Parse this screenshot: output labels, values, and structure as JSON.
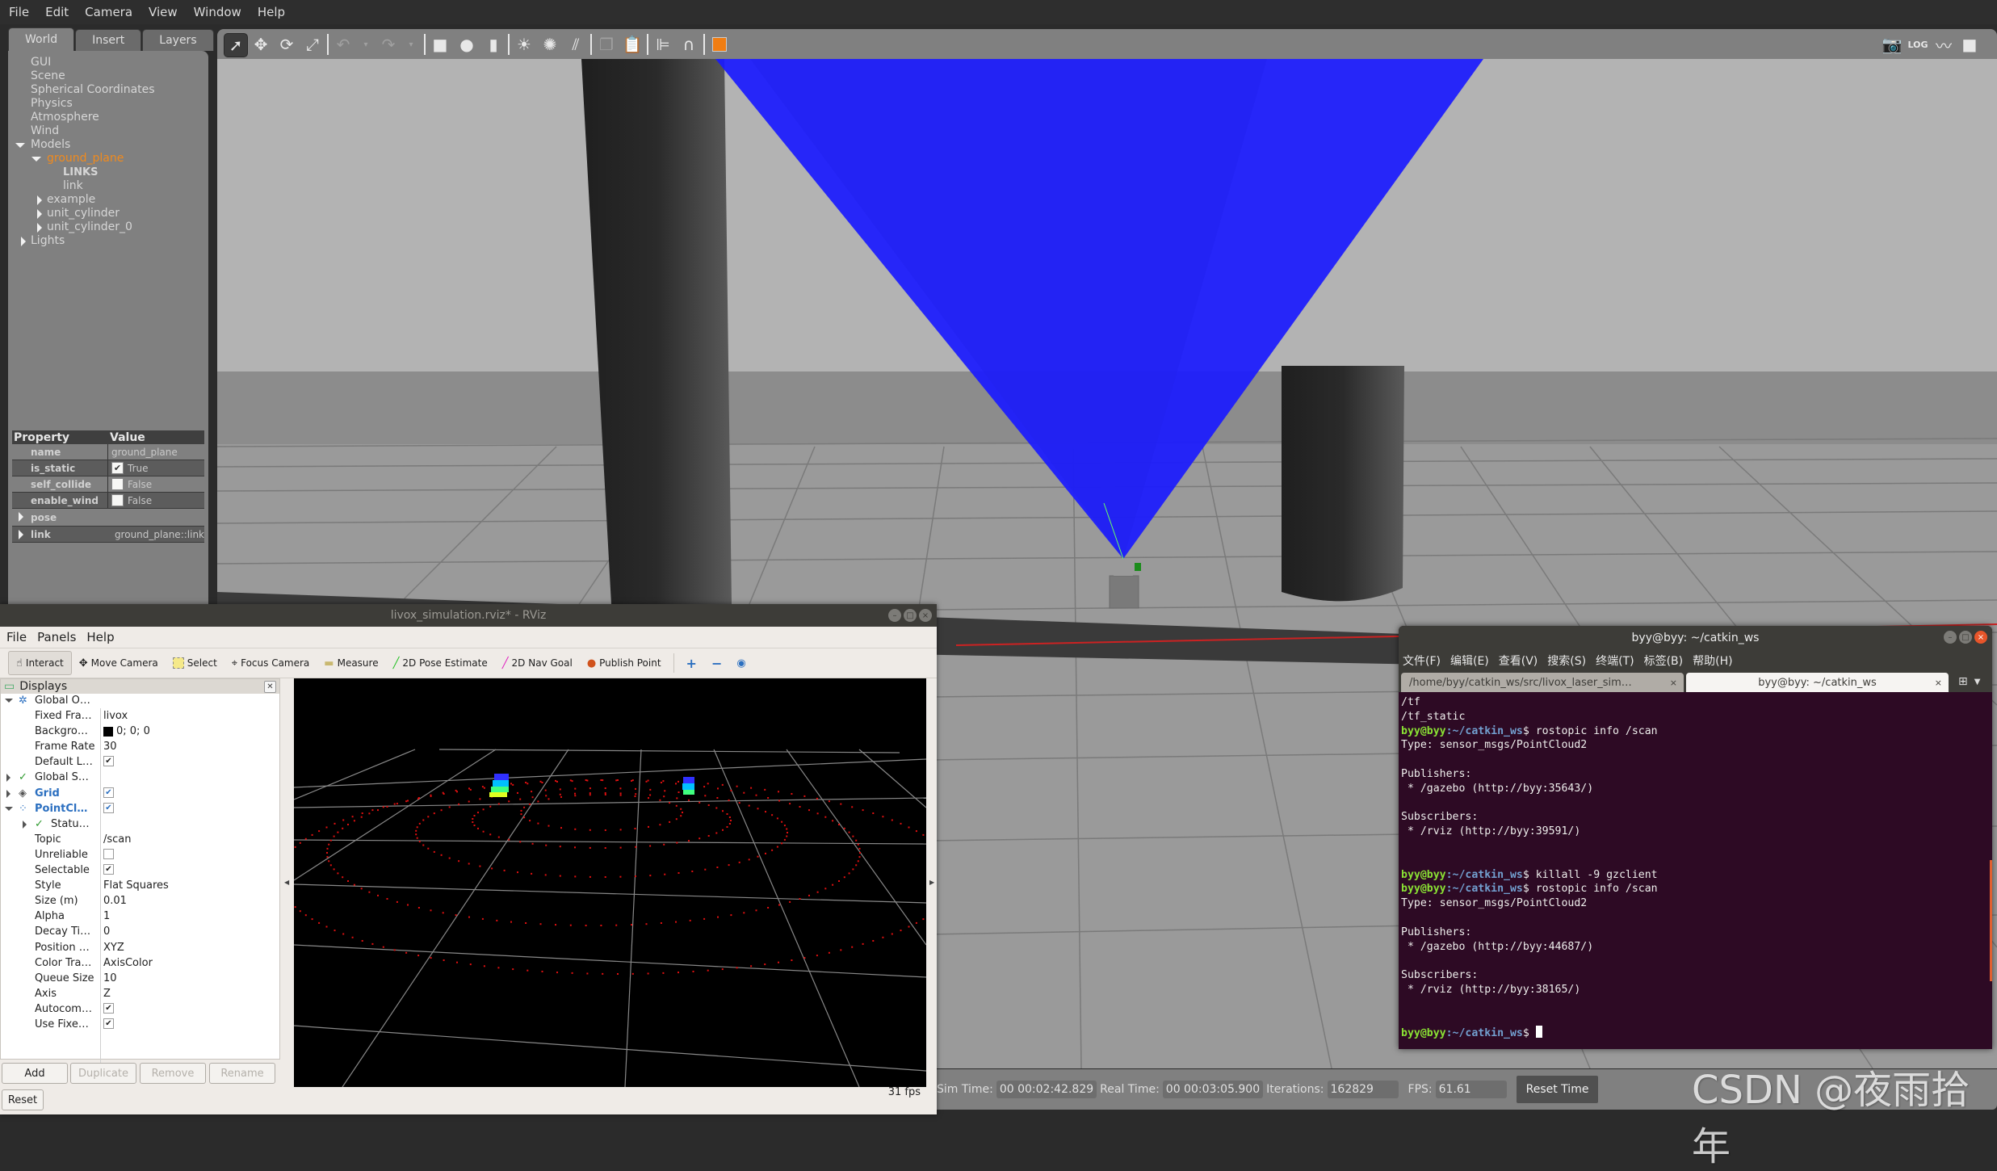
{
  "gazebo": {
    "menu": [
      "File",
      "Edit",
      "Camera",
      "View",
      "Window",
      "Help"
    ],
    "tabs": [
      "World",
      "Insert",
      "Layers"
    ],
    "world_tree": {
      "items": [
        "GUI",
        "Scene",
        "Spherical Coordinates",
        "Physics",
        "Atmosphere",
        "Wind"
      ],
      "models_label": "Models",
      "selected_model": "ground_plane",
      "links_header": "LINKS",
      "link": "link",
      "other_models": [
        "example",
        "unit_cylinder",
        "unit_cylinder_0"
      ],
      "lights_label": "Lights"
    },
    "properties": {
      "header_property": "Property",
      "header_value": "Value",
      "rows": [
        {
          "key": "name",
          "value": "ground_plane"
        },
        {
          "key": "is_static",
          "value": "True",
          "checked": true
        },
        {
          "key": "self_collide",
          "value": "False",
          "checked": false
        },
        {
          "key": "enable_wind",
          "value": "False",
          "checked": false
        }
      ],
      "groups": [
        {
          "key": "pose",
          "value": ""
        },
        {
          "key": "link",
          "value": "ground_plane::link"
        }
      ]
    },
    "toolbar_icons": [
      "select-mode",
      "translate-mode",
      "rotate-mode",
      "scale-mode",
      "undo",
      "redo",
      "box",
      "sphere",
      "cylinder",
      "point-light",
      "spot-light",
      "directional-light",
      "copy",
      "paste",
      "align",
      "snap",
      "view-angle"
    ],
    "toolbar_right_icons": [
      "screenshot",
      "log",
      "plot",
      "video-record"
    ],
    "status": {
      "sim_time_label": "Sim Time:",
      "sim_time": "00 00:02:42.829",
      "real_time_label": "Real Time:",
      "real_time": "00 00:03:05.900",
      "iterations_label": "Iterations:",
      "iterations": "162829",
      "fps_label": "FPS:",
      "fps": "61.61",
      "reset_time": "Reset Time"
    },
    "colors": {
      "laser_ray": "#1a1aff",
      "selected_model": "#f08a1d"
    }
  },
  "rviz": {
    "title": "livox_simulation.rviz* - RViz",
    "menu": [
      "File",
      "Panels",
      "Help"
    ],
    "tools": [
      {
        "label": "Interact",
        "icon": "☝"
      },
      {
        "label": "Move Camera",
        "icon": "✥"
      },
      {
        "label": "Select",
        "icon": "▭"
      },
      {
        "label": "Focus Camera",
        "icon": "⌖"
      },
      {
        "label": "Measure",
        "icon": "▬"
      },
      {
        "label": "2D Pose Estimate",
        "icon": "╱"
      },
      {
        "label": "2D Nav Goal",
        "icon": "╱"
      },
      {
        "label": "Publish Point",
        "icon": "●"
      }
    ],
    "displays_title": "Displays",
    "displays": {
      "global_options": "Global O…",
      "fixed_frame_k": "Fixed Fra…",
      "fixed_frame_v": "livox",
      "background_k": "Backgro…",
      "background_v": "0; 0; 0",
      "frame_rate_k": "Frame Rate",
      "frame_rate_v": "30",
      "default_light_k": "Default L…",
      "global_status": "Global S…",
      "grid": "Grid",
      "pointcloud": "PointCl…",
      "status": "Statu…",
      "topic_k": "Topic",
      "topic_v": "/scan",
      "unreliable_k": "Unreliable",
      "selectable_k": "Selectable",
      "style_k": "Style",
      "style_v": "Flat Squares",
      "size_k": "Size (m)",
      "size_v": "0.01",
      "alpha_k": "Alpha",
      "alpha_v": "1",
      "decay_k": "Decay Ti…",
      "decay_v": "0",
      "position_k": "Position …",
      "position_v": "XYZ",
      "color_k": "Color Tra…",
      "color_v": "AxisColor",
      "queue_k": "Queue Size",
      "queue_v": "10",
      "axis_k": "Axis",
      "axis_v": "Z",
      "autocompute_k": "Autocom…",
      "use_fixed_k": "Use Fixe…"
    },
    "buttons": {
      "add": "Add",
      "duplicate": "Duplicate",
      "remove": "Remove",
      "rename": "Rename",
      "reset": "Reset"
    },
    "fps": "31 fps"
  },
  "terminal": {
    "title": "byy@byy: ~/catkin_ws",
    "menu": [
      "文件(F)",
      "编辑(E)",
      "查看(V)",
      "搜索(S)",
      "终端(T)",
      "标签(B)",
      "帮助(H)"
    ],
    "tabs": [
      {
        "label": "/home/byy/catkin_ws/src/livox_laser_sim…",
        "active": false
      },
      {
        "label": "byy@byy: ~/catkin_ws",
        "active": true
      }
    ],
    "prompt_user": "byy@byy",
    "prompt_path": ":~/catkin_ws",
    "lines": [
      {
        "text": "/tf"
      },
      {
        "text": "/tf_static"
      },
      {
        "prompt": true,
        "cmd": "$ rostopic info /scan"
      },
      {
        "text": "Type: sensor_msgs/PointCloud2"
      },
      {
        "text": ""
      },
      {
        "text": "Publishers:"
      },
      {
        "text": " * /gazebo (http://byy:35643/)"
      },
      {
        "text": ""
      },
      {
        "text": "Subscribers:"
      },
      {
        "text": " * /rviz (http://byy:39591/)"
      },
      {
        "text": ""
      },
      {
        "text": ""
      },
      {
        "prompt": true,
        "cmd": "$ killall -9 gzclient"
      },
      {
        "prompt": true,
        "cmd": "$ rostopic info /scan"
      },
      {
        "text": "Type: sensor_msgs/PointCloud2"
      },
      {
        "text": ""
      },
      {
        "text": "Publishers:"
      },
      {
        "text": " * /gazebo (http://byy:44687/)"
      },
      {
        "text": ""
      },
      {
        "text": "Subscribers:"
      },
      {
        "text": " * /rviz (http://byy:38165/)"
      },
      {
        "text": ""
      },
      {
        "text": ""
      },
      {
        "prompt": true,
        "cmd": "$ ",
        "cursor": true
      }
    ]
  },
  "watermark": "CSDN @夜雨拾年"
}
